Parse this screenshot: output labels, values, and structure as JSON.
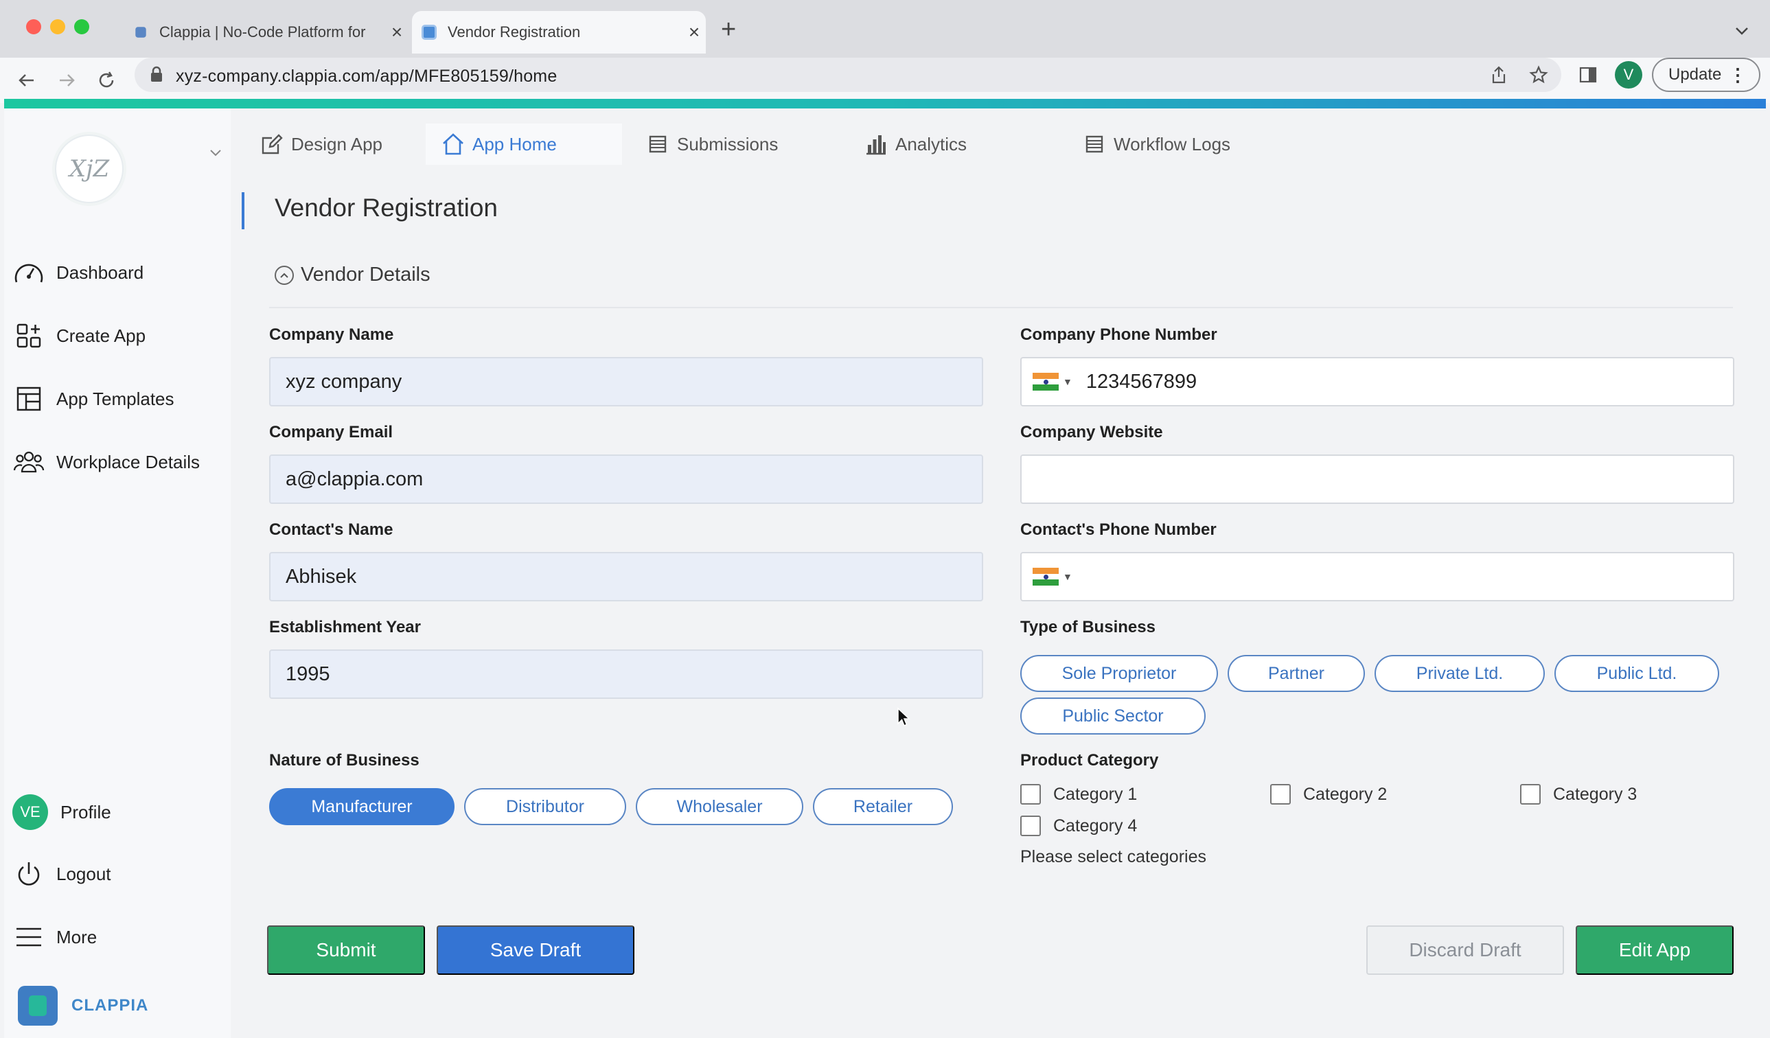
{
  "browser": {
    "tabs": [
      {
        "title": "Clappia | No-Code Platform for",
        "active": false
      },
      {
        "title": "Vendor Registration",
        "active": true
      }
    ],
    "url": "xyz-company.clappia.com/app/MFE805159/home",
    "profile_initial": "V",
    "update_label": "Update",
    "accent_gradient": [
      "#1dc7a0",
      "#2a80d8"
    ]
  },
  "sidebar": {
    "logo_text": "XjZ",
    "items": [
      {
        "label": "Dashboard",
        "icon": "speedometer-icon"
      },
      {
        "label": "Create App",
        "icon": "create-app-icon"
      },
      {
        "label": "App Templates",
        "icon": "templates-icon"
      },
      {
        "label": "Workplace Details",
        "icon": "people-icon"
      }
    ],
    "bottom_items": [
      {
        "label": "Profile",
        "avatar": "VE"
      },
      {
        "label": "Logout",
        "icon": "power-icon"
      },
      {
        "label": "More",
        "icon": "menu-icon"
      }
    ],
    "brand": "CLAPPIA"
  },
  "app_tabs": [
    {
      "label": "Design App",
      "icon": "edit-icon",
      "active": false
    },
    {
      "label": "App Home",
      "icon": "home-icon",
      "active": true
    },
    {
      "label": "Submissions",
      "icon": "list-icon",
      "active": false
    },
    {
      "label": "Analytics",
      "icon": "bar-chart-icon",
      "active": false
    },
    {
      "label": "Workflow Logs",
      "icon": "list-icon",
      "active": false
    }
  ],
  "form": {
    "title": "Vendor Registration",
    "section": "Vendor Details",
    "company_name": {
      "label": "Company Name",
      "value": "xyz company"
    },
    "company_email": {
      "label": "Company Email",
      "value": "a@clappia.com"
    },
    "contact_name": {
      "label": "Contact's Name",
      "value": "Abhisek"
    },
    "establishment_year": {
      "label": "Establishment Year",
      "value": "1995"
    },
    "company_phone": {
      "label": "Company Phone Number",
      "value": "1234567899"
    },
    "company_website": {
      "label": "Company Website",
      "value": ""
    },
    "contact_phone": {
      "label": "Contact's Phone Number",
      "value": ""
    },
    "type_of_business": {
      "label": "Type of Business",
      "options": [
        "Sole Proprietor",
        "Partner",
        "Private Ltd.",
        "Public Ltd.",
        "Public Sector"
      ],
      "selected": null
    },
    "nature_of_business": {
      "label": "Nature of Business",
      "options": [
        "Manufacturer",
        "Distributor",
        "Wholesaler",
        "Retailer"
      ],
      "selected": "Manufacturer"
    },
    "product_category": {
      "label": "Product Category",
      "options": [
        "Category 1",
        "Category 2",
        "Category 3",
        "Category 4"
      ],
      "hint": "Please select categories"
    },
    "buttons": {
      "submit": "Submit",
      "save_draft": "Save Draft",
      "discard_draft": "Discard Draft",
      "edit_app": "Edit App"
    }
  },
  "colors": {
    "primary": "#3b7bd4",
    "success": "#2fa86a",
    "input_fill": "#e9eef8"
  }
}
